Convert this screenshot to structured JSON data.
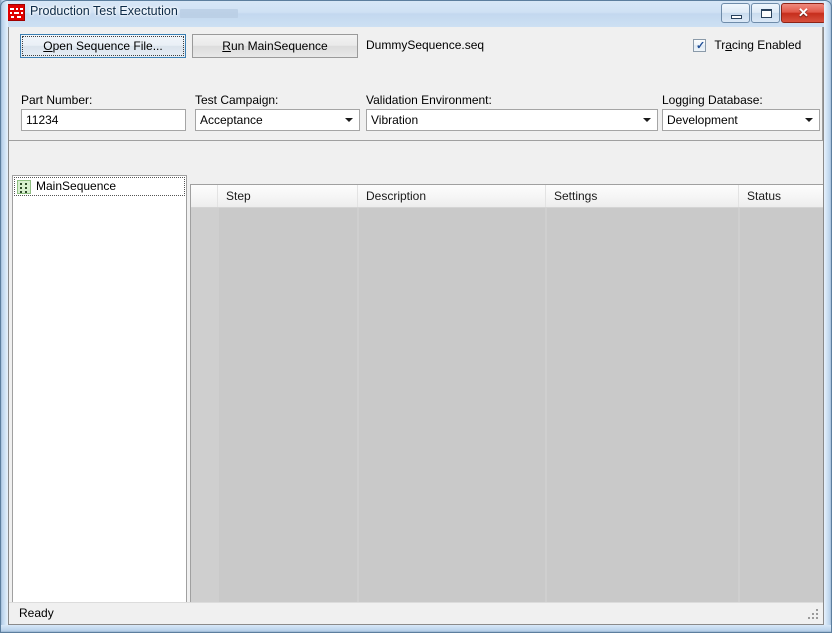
{
  "window": {
    "title": "Production Test Exectution",
    "icon": "app-red-icon",
    "controls": {
      "minimize": "minimize-icon",
      "maximize": "maximize-icon",
      "close_glyph": "✕"
    }
  },
  "toolbar": {
    "open_button": "Open Sequence File...",
    "open_button_accesskey": "O",
    "run_button": "Run MainSequence",
    "run_button_accesskey": "R",
    "sequence_filename": "DummySequence.seq",
    "tracing_label": "Tracing Enabled",
    "tracing_accesskey": "a",
    "tracing_checked": true,
    "tracing_check_glyph": "✓"
  },
  "fields": {
    "part_number": {
      "label": "Part Number:",
      "value": "11234",
      "placeholder": ""
    },
    "test_campaign": {
      "label": "Test Campaign:",
      "value": "Acceptance"
    },
    "validation_environment": {
      "label": "Validation Environment:",
      "value": "Vibration"
    },
    "logging_database": {
      "label": "Logging Database:",
      "value": "Development"
    }
  },
  "tree": {
    "root_label": "MainSequence",
    "root_icon": "sequence-icon",
    "selected": true
  },
  "list": {
    "columns": [
      {
        "label": "",
        "width": 27
      },
      {
        "label": "Step",
        "width": 140
      },
      {
        "label": "Description",
        "width": 188
      },
      {
        "label": "Settings",
        "width": 193
      },
      {
        "label": "Status",
        "width": 89
      }
    ],
    "rows": []
  },
  "statusbar": {
    "text": "Ready"
  },
  "colors": {
    "accent_focus": "#3c7fb1",
    "close_button": "#c62d1c",
    "app_icon": "#e00000",
    "tree_icon": "#d8f0cf",
    "list_body": "#cfcfcf",
    "panel": "#f0f0f0"
  }
}
